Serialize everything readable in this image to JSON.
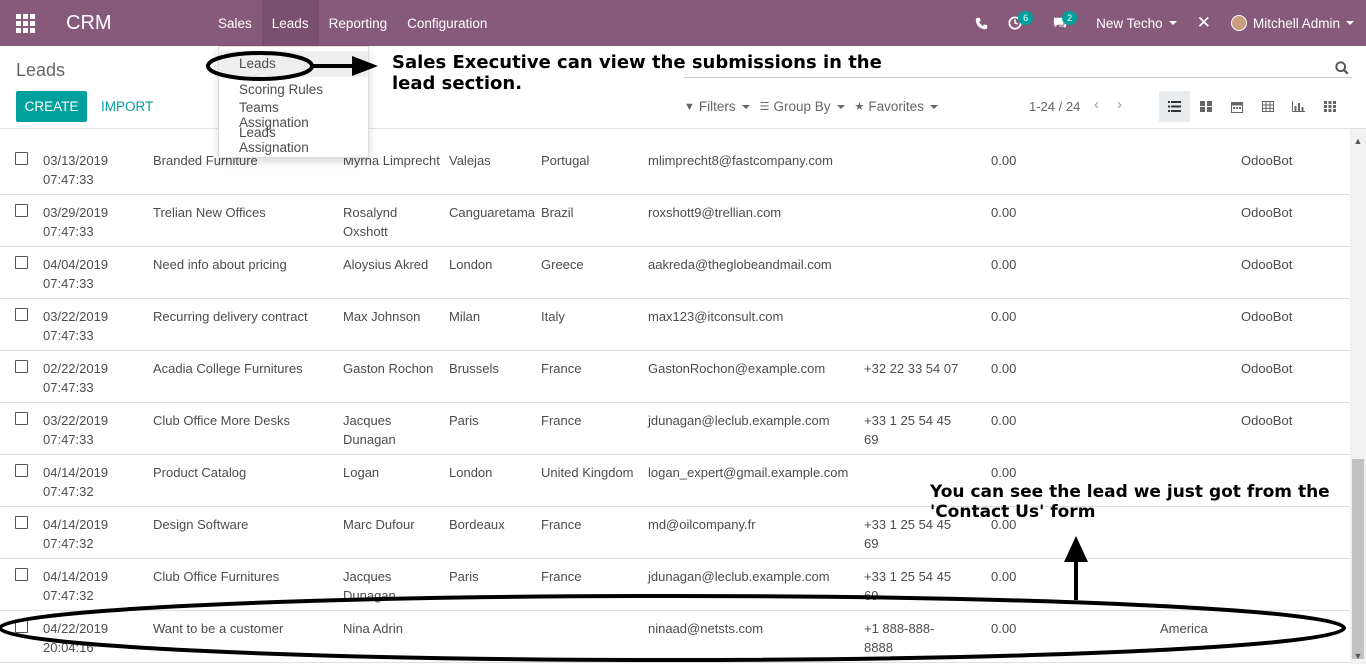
{
  "navbar": {
    "app_name": "CRM",
    "menus": [
      "Sales",
      "Leads",
      "Reporting",
      "Configuration"
    ],
    "activity_count": "6",
    "message_count": "2",
    "company": "New Techo",
    "user": "Mitchell Admin"
  },
  "dropdown": {
    "items": [
      "Leads",
      "Scoring Rules",
      "Teams Assignation",
      "Leads Assignation"
    ]
  },
  "control_panel": {
    "breadcrumb": "Leads",
    "create_label": "CREATE",
    "import_label": "IMPORT",
    "filters_label": "Filters",
    "group_by_label": "Group By",
    "favorites_label": "Favorites",
    "pager": "1-24 / 24"
  },
  "rows": [
    {
      "date": "03/13/2019",
      "time": "07:47:33",
      "name": "Branded Furniture",
      "contact": "Myrna Limprecht",
      "city": "Valejas",
      "country": "Portugal",
      "email": "mlimprecht8@fastcompany.com",
      "phone": "",
      "revenue": "0.00",
      "state": "",
      "user": "OdooBot"
    },
    {
      "date": "03/29/2019",
      "time": "07:47:33",
      "name": "Trelian New Offices",
      "contact": "Rosalynd Oxshott",
      "city": "Canguaretama",
      "country": "Brazil",
      "email": "roxshott9@trellian.com",
      "phone": "",
      "revenue": "0.00",
      "state": "",
      "user": "OdooBot"
    },
    {
      "date": "04/04/2019",
      "time": "07:47:33",
      "name": "Need info about pricing",
      "contact": "Aloysius Akred",
      "city": "London",
      "country": "Greece",
      "email": "aakreda@theglobeandmail.com",
      "phone": "",
      "revenue": "0.00",
      "state": "",
      "user": "OdooBot"
    },
    {
      "date": "03/22/2019",
      "time": "07:47:33",
      "name": "Recurring delivery contract",
      "contact": "Max Johnson",
      "city": "Milan",
      "country": "Italy",
      "email": "max123@itconsult.com",
      "phone": "",
      "revenue": "0.00",
      "state": "",
      "user": "OdooBot"
    },
    {
      "date": "02/22/2019",
      "time": "07:47:33",
      "name": "Acadia College Furnitures",
      "contact": "Gaston Rochon",
      "city": "Brussels",
      "country": "France",
      "email": "GastonRochon@example.com",
      "phone": "+32 22 33 54 07",
      "revenue": "0.00",
      "state": "",
      "user": "OdooBot"
    },
    {
      "date": "03/22/2019",
      "time": "07:47:33",
      "name": "Club Office More Desks",
      "contact": "Jacques Dunagan",
      "city": "Paris",
      "country": "France",
      "email": "jdunagan@leclub.example.com",
      "phone": "+33 1 25 54 45 69",
      "revenue": "0.00",
      "state": "",
      "user": "OdooBot"
    },
    {
      "date": "04/14/2019",
      "time": "07:47:32",
      "name": "Product Catalog",
      "contact": "Logan",
      "city": "London",
      "country": "United Kingdom",
      "email": "logan_expert@gmail.example.com",
      "phone": "",
      "revenue": "0.00",
      "state": "",
      "user": ""
    },
    {
      "date": "04/14/2019",
      "time": "07:47:32",
      "name": "Design Software",
      "contact": "Marc Dufour",
      "city": "Bordeaux",
      "country": "France",
      "email": "md@oilcompany.fr",
      "phone": "+33 1 25 54 45 69",
      "revenue": "0.00",
      "state": "",
      "user": ""
    },
    {
      "date": "04/14/2019",
      "time": "07:47:32",
      "name": "Club Office Furnitures",
      "contact": "Jacques Dunagan",
      "city": "Paris",
      "country": "France",
      "email": "jdunagan@leclub.example.com",
      "phone": "+33 1 25 54 45 69",
      "revenue": "0.00",
      "state": "",
      "user": ""
    },
    {
      "date": "04/22/2019",
      "time": "20:04:16",
      "name": "Want to be a customer",
      "contact": "Nina Adrin",
      "city": "",
      "country": "",
      "email": "ninaad@netsts.com",
      "phone": "+1 888-888-8888",
      "revenue": "0.00",
      "state": "America",
      "user": ""
    }
  ],
  "annotations": {
    "top": "Sales Executive can view the submissions in the lead section.",
    "bottom": "You can see the lead we just got from the 'Contact Us' form"
  }
}
